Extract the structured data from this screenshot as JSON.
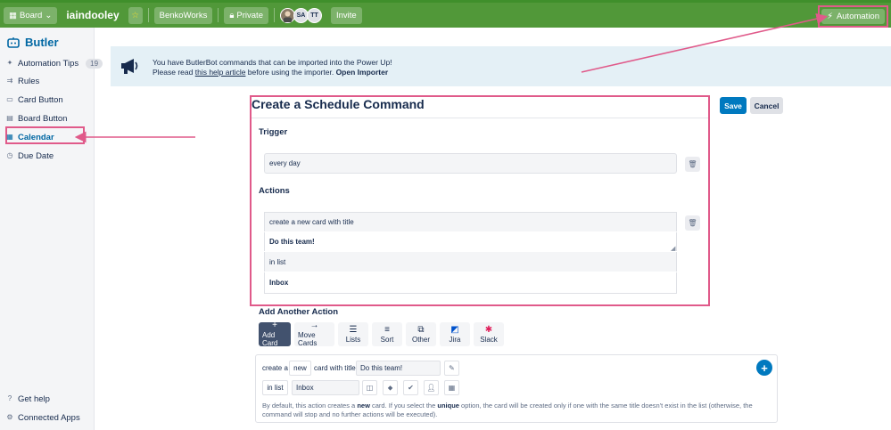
{
  "topbar": {
    "board_menu": "Board",
    "board_name": "iaindooley",
    "team": "BenkoWorks",
    "visibility": "Private",
    "avatars": [
      "SA",
      "TT"
    ],
    "invite": "Invite",
    "automation": "Automation"
  },
  "sidebar": {
    "title": "Butler",
    "items": [
      {
        "label": "Automation Tips",
        "badge": "19"
      },
      {
        "label": "Rules"
      },
      {
        "label": "Card Button"
      },
      {
        "label": "Board Button"
      },
      {
        "label": "Calendar"
      },
      {
        "label": "Due Date"
      }
    ],
    "footer": [
      {
        "label": "Get help"
      },
      {
        "label": "Connected Apps"
      }
    ]
  },
  "banner": {
    "line1": "You have ButlerBot commands that can be imported into the Power Up!",
    "line2_prefix": "Please read ",
    "line2_link": "this help article",
    "line2_mid": " before using the importer. ",
    "line2_action": "Open Importer"
  },
  "command": {
    "title": "Create a Schedule Command",
    "save": "Save",
    "cancel": "Cancel",
    "trigger_label": "Trigger",
    "trigger_value": "every day",
    "actions_label": "Actions",
    "action_lines": [
      "create a new card with title",
      "Do this team!",
      "in list",
      "Inbox"
    ]
  },
  "add_action": {
    "label": "Add Another Action",
    "tabs": [
      "Add Card",
      "Move Cards",
      "Lists",
      "Sort",
      "Other",
      "Jira",
      "Slack"
    ],
    "builder": {
      "create_a": "create a",
      "new": "new",
      "card_with_title": "card with title",
      "title_value": "Do this team!",
      "in_list": "in list",
      "list_value": "Inbox",
      "note_1": "By default, this action creates a ",
      "note_new": "new",
      "note_2": " card. If you select the ",
      "note_unique": "unique",
      "note_3": " option, the card will be created only if one with the same title doesn't exist in the list (otherwise, the command will stop and no further actions will be executed)."
    }
  },
  "colors": {
    "topbar": "#519839",
    "accent": "#0079bf",
    "highlight": "#e05a8a"
  }
}
